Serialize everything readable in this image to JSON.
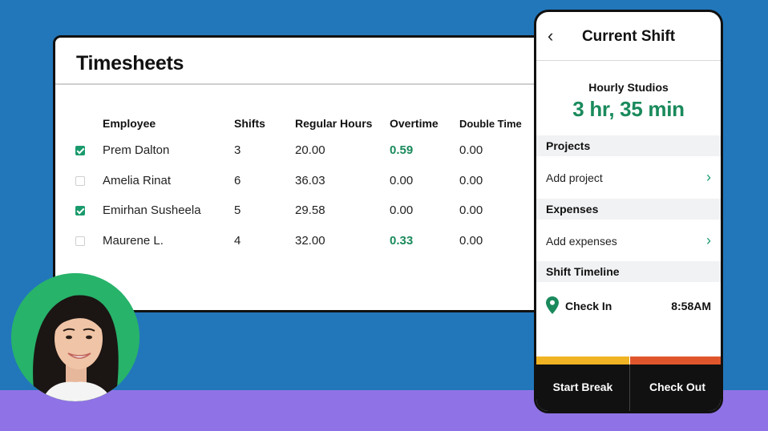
{
  "timesheets": {
    "title": "Timesheets",
    "columns": [
      "Employee",
      "Shifts",
      "Regular Hours",
      "Overtime",
      "Double Time"
    ],
    "rows": [
      {
        "employee": "Prem Dalton",
        "shifts": "3",
        "regular": "20.00",
        "overtime": "0.59",
        "double": "0.00",
        "checked": true
      },
      {
        "employee": "Amelia Rinat",
        "shifts": "6",
        "regular": "36.03",
        "overtime": "0.00",
        "double": "0.00",
        "checked": false
      },
      {
        "employee": "Emirhan Susheela",
        "shifts": "5",
        "regular": "29.58",
        "overtime": "0.00",
        "double": "0.00",
        "checked": true
      },
      {
        "employee": "Maurene L.",
        "shifts": "4",
        "regular": "32.00",
        "overtime": "0.33",
        "double": "0.00",
        "checked": false
      }
    ]
  },
  "phone": {
    "title": "Current Shift",
    "back_icon": "chevron-left-icon",
    "company": "Hourly Studios",
    "duration": "3 hr, 35 min",
    "sections": {
      "projects": "Projects",
      "add_project": "Add project",
      "expenses": "Expenses",
      "add_expenses": "Add expenses",
      "timeline": "Shift Timeline"
    },
    "checkin": {
      "label": "Check In",
      "time": "8:58AM",
      "icon": "location-pin-icon"
    },
    "buttons": {
      "start_break": "Start Break",
      "check_out": "Check Out"
    }
  },
  "colors": {
    "background": "#2277bb",
    "band": "#8f72e6",
    "accent_green": "#1a8a5c",
    "avatar_bg": "#27b36a",
    "bar_yellow": "#f0b323",
    "bar_orange": "#e0562c"
  }
}
